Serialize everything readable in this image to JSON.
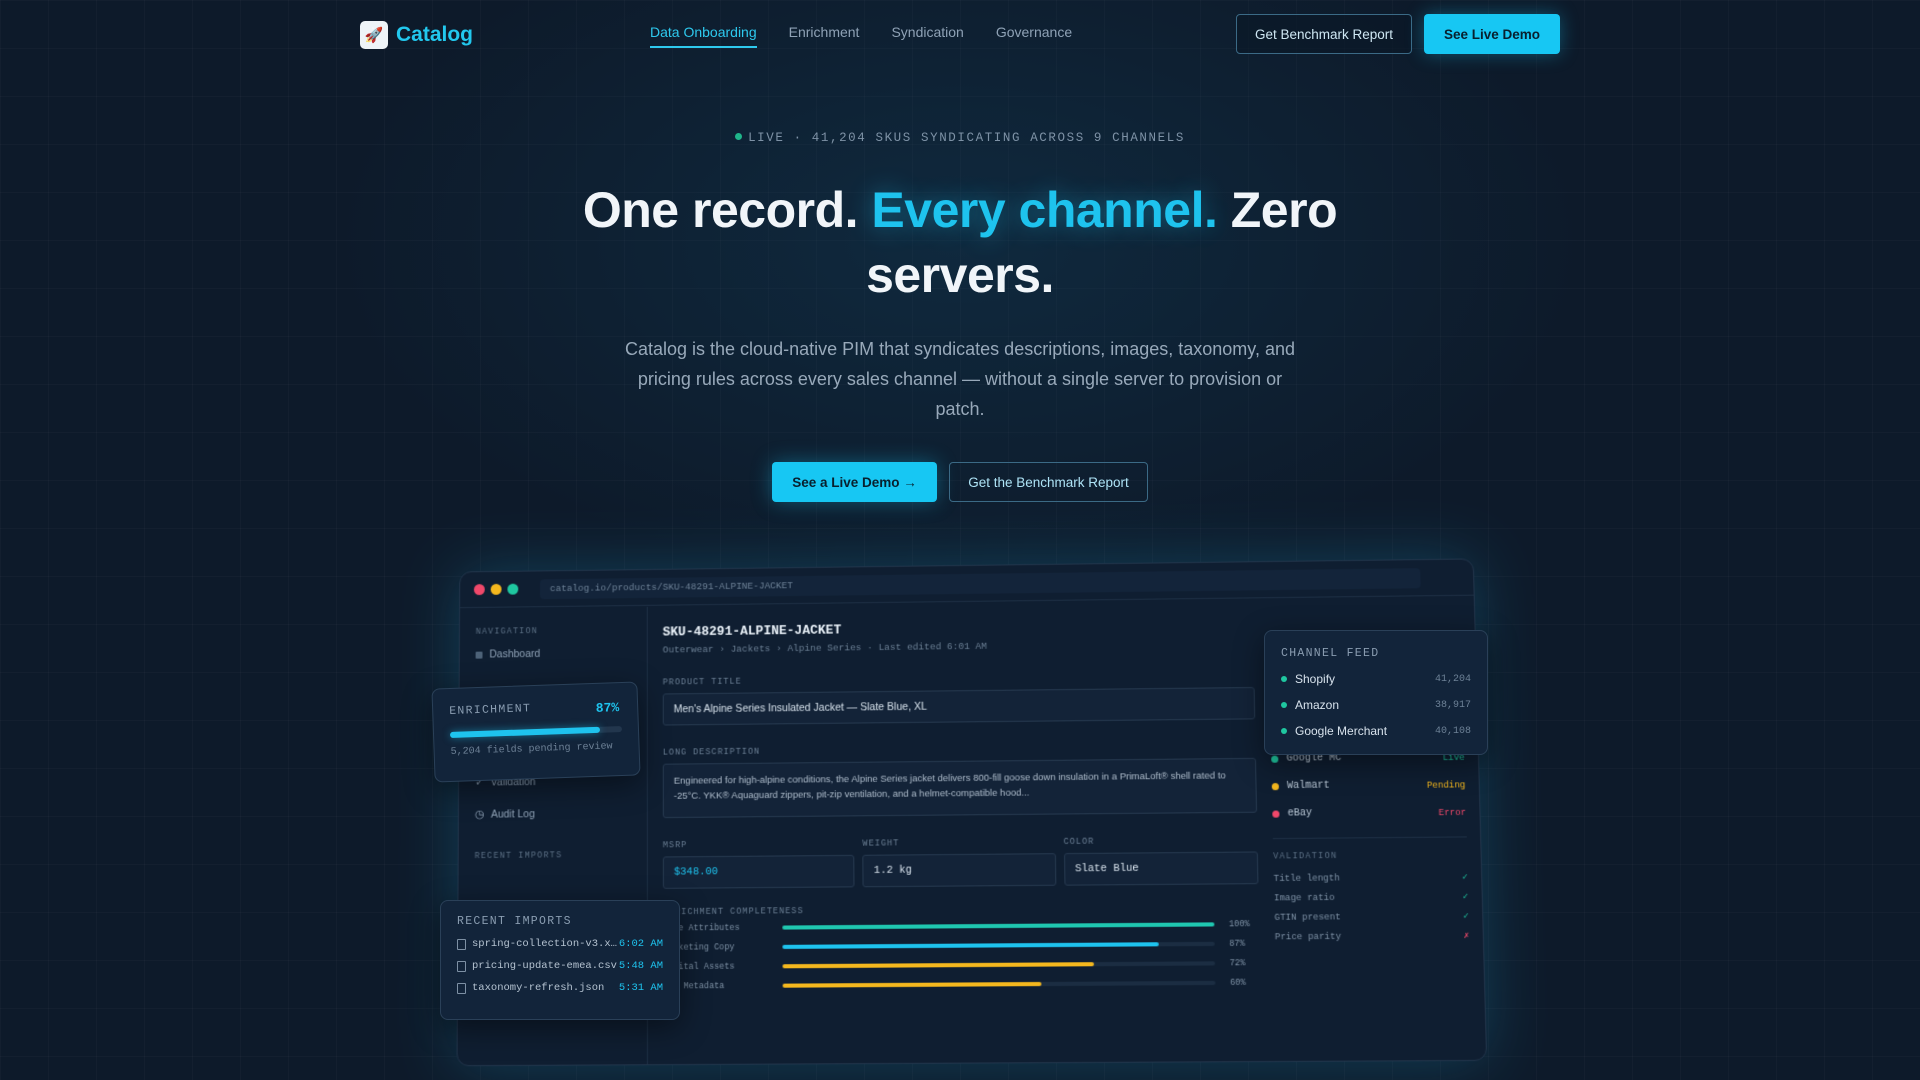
{
  "nav": {
    "brand": "Catalog",
    "links": [
      "Data Onboarding",
      "Enrichment",
      "Syndication",
      "Governance"
    ],
    "benchmark_btn": "Get Benchmark Report",
    "demo_btn": "See Live Demo"
  },
  "hero": {
    "live_badge": "LIVE · 41,204 SKUS SYNDICATING ACROSS 9 CHANNELS",
    "headline_part1": "One record. ",
    "headline_accent": "Every channel.",
    "headline_part2": " Zero servers.",
    "subtitle": "Catalog is the cloud-native PIM that syndicates descriptions, images, taxonomy, and pricing rules across every sales channel — without a single server to provision or patch.",
    "cta_primary": "See a Live Demo →",
    "cta_secondary": "Get the Benchmark Report"
  },
  "app": {
    "url": "catalog.io/products/SKU-48291-ALPINE-JACKET",
    "sidebar": {
      "nav_heading": "NAVIGATION",
      "dashboard": "Dashboard",
      "validation": "Validation",
      "audit_log": "Audit Log",
      "imports_heading": "RECENT IMPORTS"
    },
    "product": {
      "sku": "SKU-48291-ALPINE-JACKET",
      "breadcrumb": "Outerwear › Jackets › Alpine Series · Last edited 6:01 AM",
      "title_label": "PRODUCT TITLE",
      "title_value": "Men's Alpine Series Insulated Jacket — Slate Blue, XL",
      "desc_label": "LONG DESCRIPTION",
      "desc_value": "Engineered for high-alpine conditions, the Alpine Series jacket delivers 800-fill goose down insulation in a PrimaLoft® shell rated to -25°C. YKK® Aquaguard zippers, pit-zip ventilation, and a helmet-compatible hood...",
      "msrp_label": "MSRP",
      "msrp_value": "$348.00",
      "weight_label": "WEIGHT",
      "weight_value": "1.2 kg",
      "color_label": "COLOR",
      "color_value": "Slate Blue"
    },
    "completeness": {
      "heading": "ENRICHMENT COMPLETENESS",
      "rows": [
        {
          "label": "Core Attributes",
          "pct": "100%",
          "value": 1.0,
          "color": "#1fc7b0"
        },
        {
          "label": "Marketing Copy",
          "pct": "87%",
          "value": 0.87,
          "color": "#1ec3ee"
        },
        {
          "label": "Digital Assets",
          "pct": "72%",
          "value": 0.72,
          "color": "#f5b81e"
        },
        {
          "label": "SEO Metadata",
          "pct": "60%",
          "value": 0.6,
          "color": "#f5b81e"
        }
      ]
    },
    "channels": [
      {
        "name": "Google MC",
        "status": "Live",
        "dot": "#1fc7a0",
        "color": "#1fc7a0"
      },
      {
        "name": "Walmart",
        "status": "Pending",
        "dot": "#f5b81e",
        "color": "#f5b81e"
      },
      {
        "name": "eBay",
        "status": "Error",
        "dot": "#f0486a",
        "color": "#f0486a"
      }
    ],
    "validation": {
      "heading": "VALIDATION",
      "rows": [
        {
          "label": "Title length",
          "mark": "✓",
          "color": "#1fc7a0"
        },
        {
          "label": "Image ratio",
          "mark": "✓",
          "color": "#1fc7a0"
        },
        {
          "label": "GTIN present",
          "mark": "✓",
          "color": "#1fc7a0"
        },
        {
          "label": "Price parity",
          "mark": "✗",
          "color": "#f0486a"
        }
      ]
    }
  },
  "cards": {
    "enrichment": {
      "title": "ENRICHMENT",
      "pct": "87%",
      "value": 0.87,
      "note": "5,204 fields pending review"
    },
    "imports": {
      "title": "RECENT IMPORTS",
      "rows": [
        {
          "file": "spring-collection-v3.x…",
          "time": "6:02 AM"
        },
        {
          "file": "pricing-update-emea.csv",
          "time": "5:48 AM"
        },
        {
          "file": "taxonomy-refresh.json",
          "time": "5:31 AM"
        }
      ]
    },
    "channel_feed": {
      "title": "CHANNEL FEED",
      "rows": [
        {
          "name": "Shopify",
          "count": "41,204"
        },
        {
          "name": "Amazon",
          "count": "38,917"
        },
        {
          "name": "Google Merchant",
          "count": "40,108"
        }
      ]
    }
  },
  "colors": {
    "accent": "#17c7f3",
    "bg": "#0d1a2a"
  }
}
